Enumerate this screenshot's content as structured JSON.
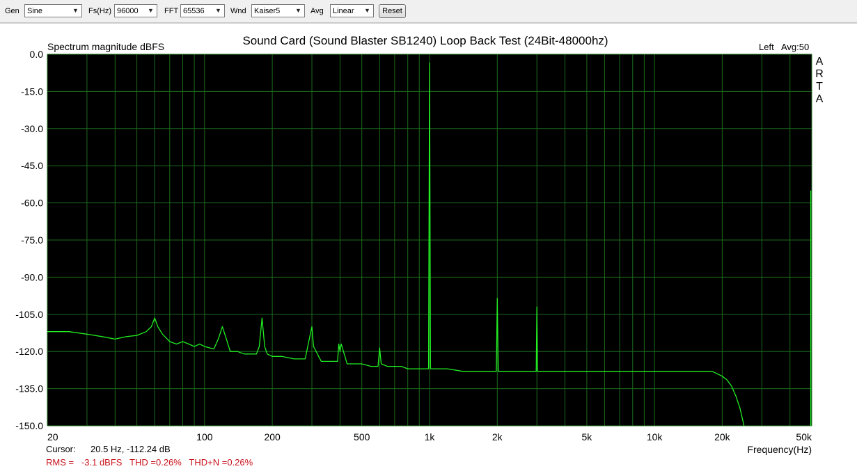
{
  "toolbar": {
    "gen_label": "Gen",
    "gen_value": "Sine",
    "fs_label": "Fs(Hz)",
    "fs_value": "96000",
    "fft_label": "FFT",
    "fft_value": "65536",
    "wnd_label": "Wnd",
    "wnd_value": "Kaiser5",
    "avg_label": "Avg",
    "avg_value": "Linear",
    "reset_label": "Reset"
  },
  "chart_data": {
    "type": "line",
    "title": "Sound Card (Sound Blaster SB1240) Loop Back Test (24Bit-48000hz)",
    "ylabel": "Spectrum magnitude dBFS",
    "xlabel": "Frequency(Hz)",
    "channel_label": "Left",
    "avg_label": "Avg:50",
    "watermark": "ARTA",
    "xscale": "log",
    "xlim": [
      20,
      50000
    ],
    "ylim": [
      -150,
      0
    ],
    "x_ticks": [
      20,
      100,
      200,
      500,
      1000,
      2000,
      5000,
      10000,
      20000,
      50000
    ],
    "x_tick_labels": [
      "20",
      "100",
      "200",
      "500",
      "1k",
      "2k",
      "5k",
      "10k",
      "20k",
      "50k"
    ],
    "y_ticks": [
      0,
      -15,
      -30,
      -45,
      -60,
      -75,
      -90,
      -105,
      -120,
      -135,
      -150
    ],
    "y_tick_labels": [
      "0.0",
      "-15.0",
      "-30.0",
      "-45.0",
      "-60.0",
      "-75.0",
      "-90.0",
      "-105.0",
      "-120.0",
      "-135.0",
      "-150.0"
    ],
    "grid": true,
    "background": "#000000",
    "grid_color": "#1c6b1c",
    "line_color": "#22ee22",
    "series": [
      {
        "x": [
          20,
          25,
          30,
          35,
          40,
          45,
          50,
          55,
          58,
          60,
          62,
          65,
          70,
          75,
          80,
          85,
          90,
          95,
          100,
          110,
          115,
          120,
          125,
          130,
          140,
          150,
          160,
          170,
          175,
          180,
          185,
          190,
          200,
          220,
          250,
          280,
          295,
          300,
          305,
          330,
          360,
          390,
          395,
          400,
          405,
          430,
          450,
          480,
          500,
          550,
          590,
          600,
          610,
          650,
          700,
          750,
          800,
          850,
          900,
          950,
          990,
          1000,
          1010,
          1050,
          1100,
          1200,
          1400,
          1600,
          1800,
          1980,
          2000,
          2020,
          2200,
          2500,
          2800,
          2980,
          3000,
          3020,
          3500,
          4000,
          5000,
          6000,
          7000,
          8000,
          10000,
          12000,
          14000,
          16000,
          18000,
          19000,
          20000,
          21000,
          22000,
          23000,
          24000,
          25000
        ],
        "y": [
          -112,
          -112,
          -113,
          -114,
          -115,
          -114,
          -113.5,
          -112,
          -110,
          -106.5,
          -110,
          -113,
          -116,
          -117,
          -116,
          -117,
          -118,
          -117,
          -118,
          -119,
          -115,
          -110,
          -115,
          -120,
          -120,
          -121,
          -121,
          -121,
          -118,
          -106.5,
          -118,
          -121,
          -122,
          -122,
          -123,
          -123,
          -113,
          -110,
          -118,
          -124,
          -124,
          -124,
          -117,
          -120,
          -117,
          -125,
          -125,
          -125,
          -125,
          -126,
          -126,
          -118.5,
          -125,
          -126,
          -126,
          -126,
          -127,
          -127,
          -127,
          -127,
          -127,
          -3.5,
          -127,
          -127,
          -127,
          -127,
          -128,
          -128,
          -128,
          -128,
          -98.5,
          -128,
          -128,
          -128,
          -128,
          -128,
          -102,
          -128,
          -128,
          -128,
          -128,
          -128,
          -128,
          -128,
          -128,
          -128,
          -128,
          -128,
          -128,
          -129,
          -130,
          -131.5,
          -134,
          -138,
          -143,
          -150
        ]
      }
    ],
    "spurs": [
      {
        "x": 49500,
        "y": -55,
        "floor": -150
      }
    ]
  },
  "readout": {
    "cursor_label": "Cursor:",
    "cursor_value": "20.5 Hz, -112.24 dB",
    "rms_text": "RMS =   -3.1 dBFS   THD =0.26%   THD+N =0.26%"
  }
}
